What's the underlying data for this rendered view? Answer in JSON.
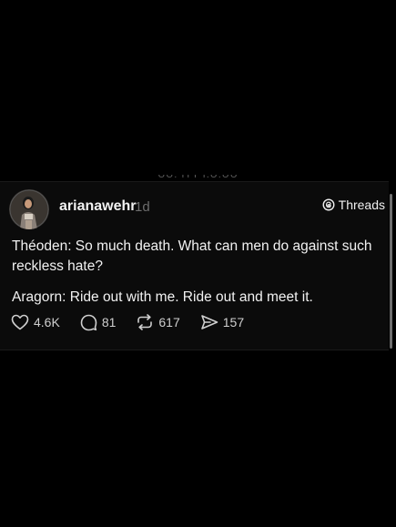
{
  "post": {
    "username": "arianawehr",
    "time": "1d",
    "source_label": "Threads",
    "lines": [
      "Théoden: So much death. What can men do against such reckless hate?",
      "Aragorn: Ride out with me. Ride out and meet it."
    ],
    "actions": {
      "likes": "4.6K",
      "replies": "81",
      "reposts": "617",
      "shares": "157"
    }
  },
  "icons": {
    "avatar": "avatar-photo",
    "threads": "threads-logo-icon",
    "like": "heart-icon",
    "reply": "comment-icon",
    "repost": "repost-icon",
    "share": "send-icon"
  },
  "colors": {
    "background": "#000000",
    "card": "#0b0b0b",
    "text": "#f2f2f2",
    "muted": "#6d6d6d"
  }
}
